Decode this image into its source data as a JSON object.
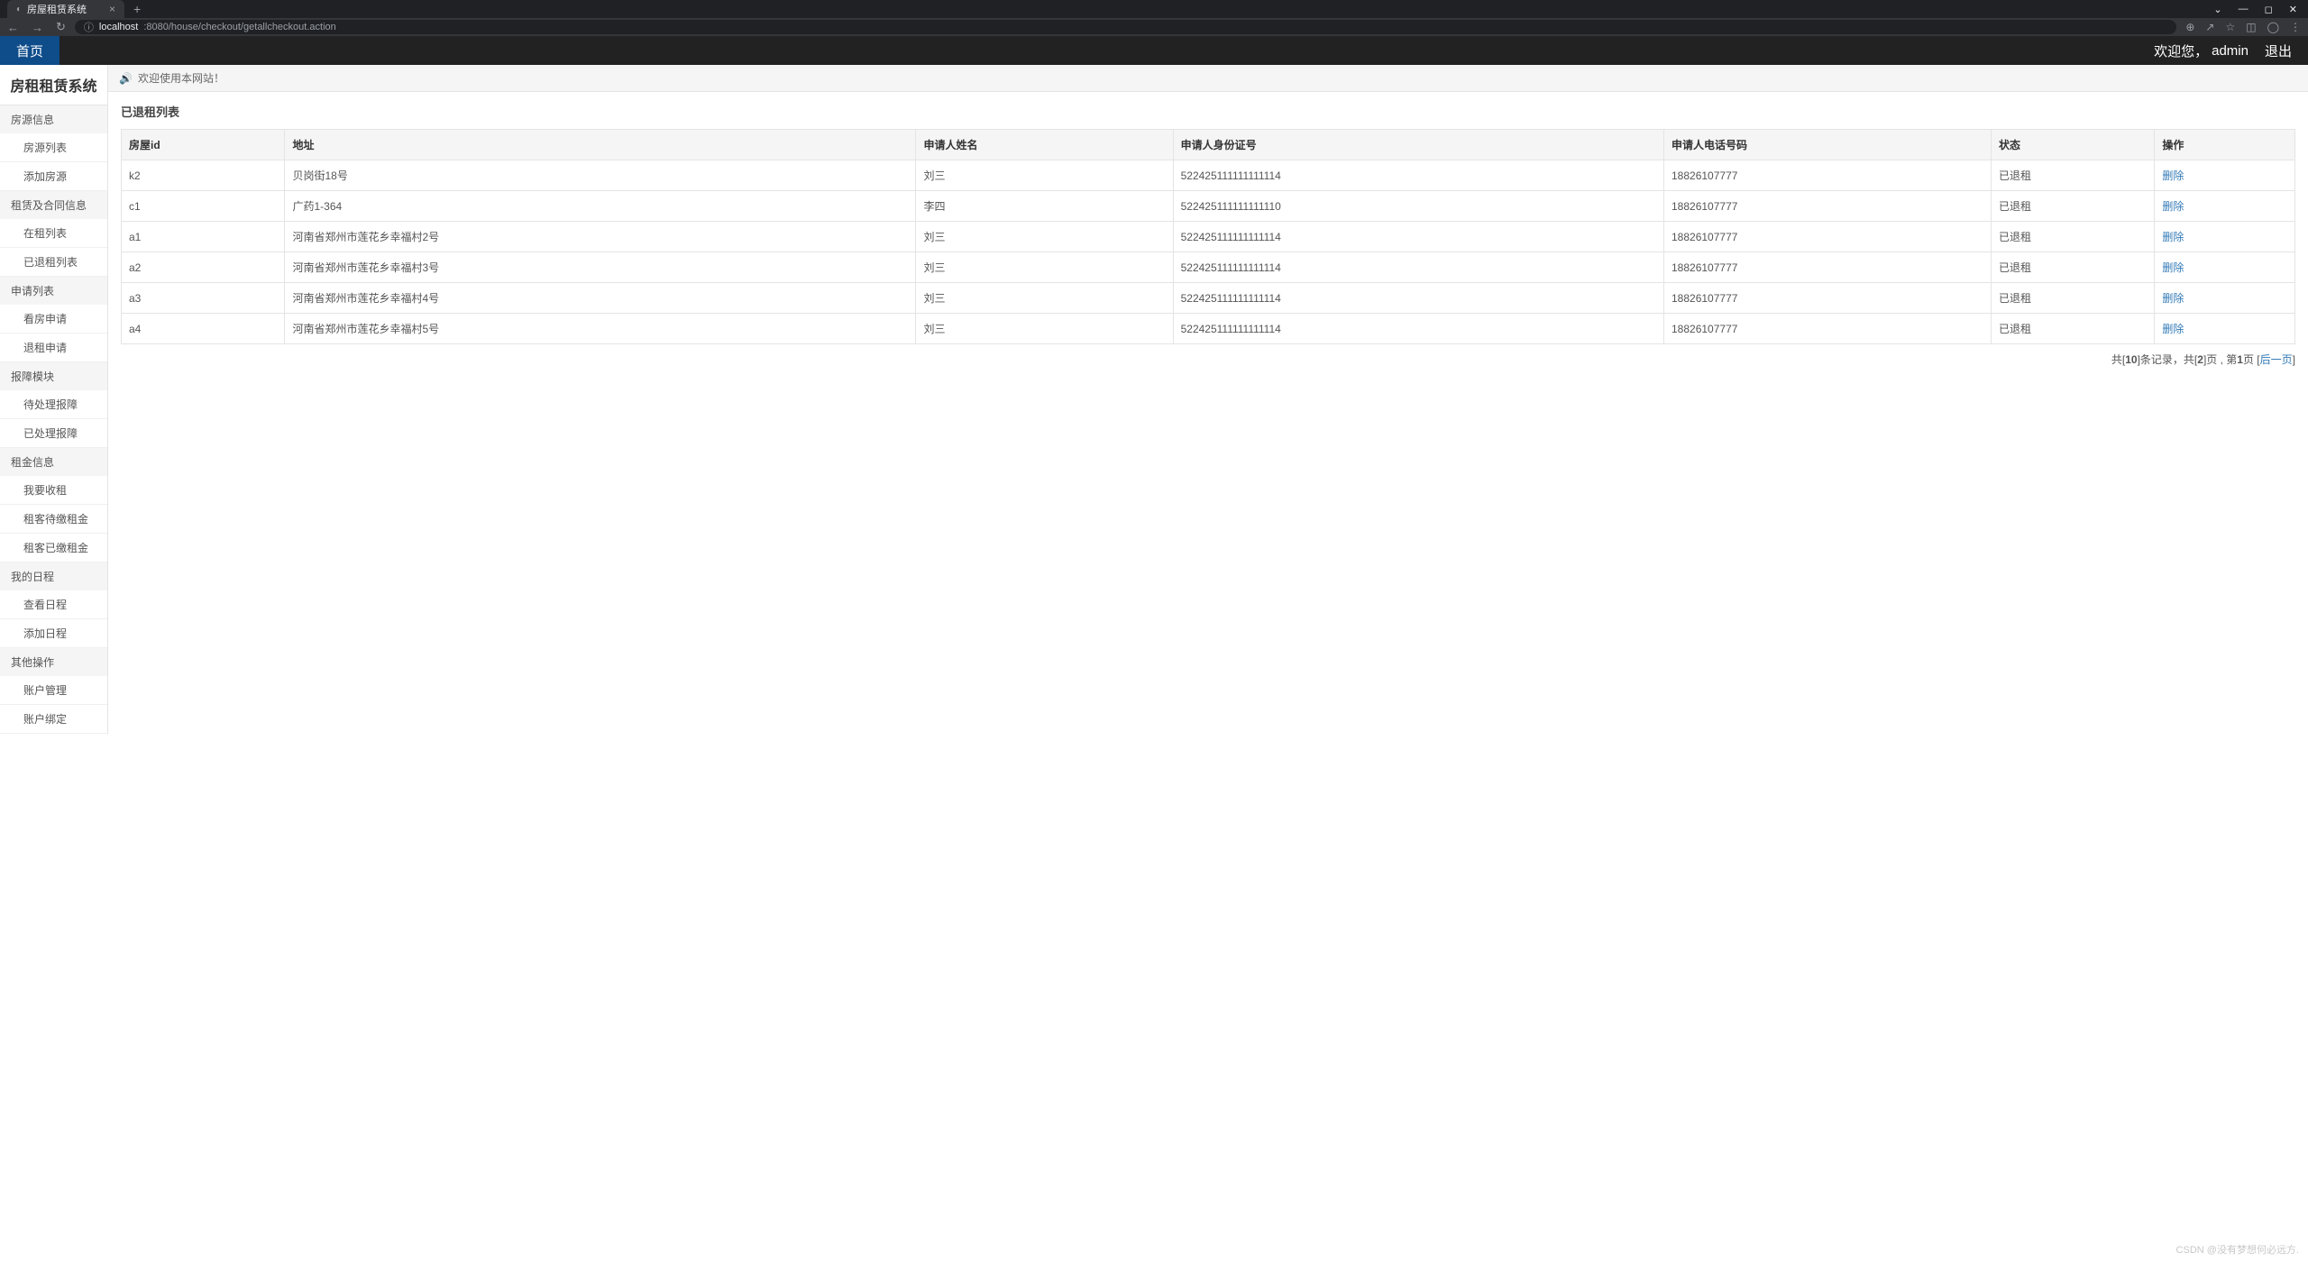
{
  "browser": {
    "tab_title": "房屋租赁系统",
    "url_host": "localhost",
    "url_path": ":8080/house/checkout/getallcheckout.action"
  },
  "navbar": {
    "home": "首页",
    "welcome_prefix": "欢迎您，",
    "username": "admin",
    "logout": "退出"
  },
  "sidebar": {
    "brand": "房租租赁系统",
    "groups": [
      {
        "label": "房源信息",
        "items": [
          "房源列表",
          "添加房源"
        ]
      },
      {
        "label": "租赁及合同信息",
        "items": [
          "在租列表",
          "已退租列表"
        ]
      },
      {
        "label": "申请列表",
        "items": [
          "看房申请",
          "退租申请"
        ]
      },
      {
        "label": "报障模块",
        "items": [
          "待处理报障",
          "已处理报障"
        ]
      },
      {
        "label": "租金信息",
        "items": [
          "我要收租",
          "租客待缴租金",
          "租客已缴租金"
        ]
      },
      {
        "label": "我的日程",
        "items": [
          "查看日程",
          "添加日程"
        ]
      },
      {
        "label": "其他操作",
        "items": [
          "账户管理",
          "账户绑定"
        ]
      }
    ]
  },
  "announcement": "欢迎使用本网站！",
  "page": {
    "title": "已退租列表",
    "columns": [
      "房屋id",
      "地址",
      "申请人姓名",
      "申请人身份证号",
      "申请人电话号码",
      "状态",
      "操作"
    ],
    "action_label": "删除",
    "rows": [
      {
        "id": "k2",
        "addr": "贝岗街18号",
        "name": "刘三",
        "idno": "522425111111111114",
        "phone": "18826107777",
        "status": "已退租"
      },
      {
        "id": "c1",
        "addr": "广药1-364",
        "name": "李四",
        "idno": "522425111111111110",
        "phone": "18826107777",
        "status": "已退租"
      },
      {
        "id": "a1",
        "addr": "河南省郑州市莲花乡幸福村2号",
        "name": "刘三",
        "idno": "522425111111111114",
        "phone": "18826107777",
        "status": "已退租"
      },
      {
        "id": "a2",
        "addr": "河南省郑州市莲花乡幸福村3号",
        "name": "刘三",
        "idno": "522425111111111114",
        "phone": "18826107777",
        "status": "已退租"
      },
      {
        "id": "a3",
        "addr": "河南省郑州市莲花乡幸福村4号",
        "name": "刘三",
        "idno": "522425111111111114",
        "phone": "18826107777",
        "status": "已退租"
      },
      {
        "id": "a4",
        "addr": "河南省郑州市莲花乡幸福村5号",
        "name": "刘三",
        "idno": "522425111111111114",
        "phone": "18826107777",
        "status": "已退租"
      }
    ],
    "pager": {
      "total_records": "10",
      "total_pages": "2",
      "current_page": "1",
      "next_label": "后一页",
      "text_prefix": "共[",
      "text_mid1": "]条记录，共[",
      "text_mid2": "]页 , 第",
      "text_mid3": "页 ["
    }
  },
  "watermark": "CSDN @没有梦想何必远方."
}
